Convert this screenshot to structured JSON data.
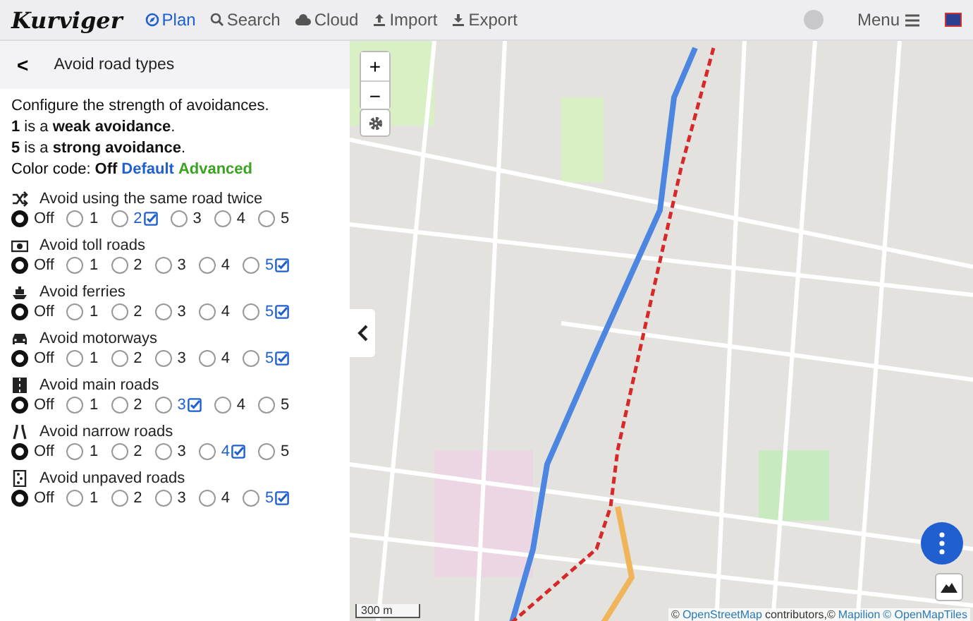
{
  "header": {
    "logo": "Kurviger",
    "nav": [
      {
        "label": "Plan",
        "kind": "plan",
        "selected": true
      },
      {
        "label": "Search",
        "kind": "search",
        "selected": false
      },
      {
        "label": "Cloud",
        "kind": "cloud",
        "selected": false
      },
      {
        "label": "Import",
        "kind": "import",
        "selected": false
      },
      {
        "label": "Export",
        "kind": "export",
        "selected": false
      }
    ],
    "menu": "Menu"
  },
  "panel": {
    "back": "<",
    "title": "Avoid road types",
    "intro": [
      "Configure the strength of avoidances.",
      "**1** is a **weak avoidance**.",
      "**5** is a **strong avoidance**."
    ],
    "color_code": {
      "label": "Color code:",
      "items": [
        {
          "label": "Off",
          "color": "#111111"
        },
        {
          "label": "Default",
          "color": "#1f5fd0"
        },
        {
          "label": "Advanced",
          "color": "#3aa321"
        }
      ]
    },
    "avoidances": [
      {
        "title": "Avoid using the same road twice",
        "kind": "shuffle",
        "options": [
          {
            "label": "Off",
            "selected": true,
            "default": false
          },
          {
            "label": "1",
            "selected": false,
            "default": false
          },
          {
            "label": "2",
            "selected": false,
            "default": true
          },
          {
            "label": "3",
            "selected": false,
            "default": false
          },
          {
            "label": "4",
            "selected": false,
            "default": false
          },
          {
            "label": "5",
            "selected": false,
            "default": false
          }
        ]
      },
      {
        "title": "Avoid toll roads",
        "kind": "money",
        "options": [
          {
            "label": "Off",
            "selected": true,
            "default": false
          },
          {
            "label": "1",
            "selected": false,
            "default": false
          },
          {
            "label": "2",
            "selected": false,
            "default": false
          },
          {
            "label": "3",
            "selected": false,
            "default": false
          },
          {
            "label": "4",
            "selected": false,
            "default": false
          },
          {
            "label": "5",
            "selected": false,
            "default": true
          }
        ]
      },
      {
        "title": "Avoid ferries",
        "kind": "ship",
        "options": [
          {
            "label": "Off",
            "selected": true,
            "default": false
          },
          {
            "label": "1",
            "selected": false,
            "default": false
          },
          {
            "label": "2",
            "selected": false,
            "default": false
          },
          {
            "label": "3",
            "selected": false,
            "default": false
          },
          {
            "label": "4",
            "selected": false,
            "default": false
          },
          {
            "label": "5",
            "selected": false,
            "default": true
          }
        ]
      },
      {
        "title": "Avoid motorways",
        "kind": "car",
        "options": [
          {
            "label": "Off",
            "selected": true,
            "default": false
          },
          {
            "label": "1",
            "selected": false,
            "default": false
          },
          {
            "label": "2",
            "selected": false,
            "default": false
          },
          {
            "label": "3",
            "selected": false,
            "default": false
          },
          {
            "label": "4",
            "selected": false,
            "default": false
          },
          {
            "label": "5",
            "selected": false,
            "default": true
          }
        ]
      },
      {
        "title": "Avoid main roads",
        "kind": "road",
        "options": [
          {
            "label": "Off",
            "selected": true,
            "default": false
          },
          {
            "label": "1",
            "selected": false,
            "default": false
          },
          {
            "label": "2",
            "selected": false,
            "default": false
          },
          {
            "label": "3",
            "selected": false,
            "default": true
          },
          {
            "label": "4",
            "selected": false,
            "default": false
          },
          {
            "label": "5",
            "selected": false,
            "default": false
          }
        ]
      },
      {
        "title": "Avoid narrow roads",
        "kind": "narrow",
        "options": [
          {
            "label": "Off",
            "selected": true,
            "default": false
          },
          {
            "label": "1",
            "selected": false,
            "default": false
          },
          {
            "label": "2",
            "selected": false,
            "default": false
          },
          {
            "label": "3",
            "selected": false,
            "default": false
          },
          {
            "label": "4",
            "selected": false,
            "default": true
          },
          {
            "label": "5",
            "selected": false,
            "default": false
          }
        ]
      },
      {
        "title": "Avoid unpaved roads",
        "kind": "unpaved",
        "options": [
          {
            "label": "Off",
            "selected": true,
            "default": false
          },
          {
            "label": "1",
            "selected": false,
            "default": false
          },
          {
            "label": "2",
            "selected": false,
            "default": false
          },
          {
            "label": "3",
            "selected": false,
            "default": false
          },
          {
            "label": "4",
            "selected": false,
            "default": false
          },
          {
            "label": "5",
            "selected": false,
            "default": true
          }
        ]
      }
    ]
  },
  "map": {
    "zoom_in": "+",
    "zoom_out": "−",
    "scale": "300 m",
    "attribution": [
      {
        "text": "©",
        "link": false
      },
      {
        "text": "OpenStreetMap",
        "link": true
      },
      {
        "text": "contributors,©",
        "link": false
      },
      {
        "text": "Mapilion",
        "link": true
      },
      {
        "text": "© OpenMapTiles",
        "link": true
      }
    ]
  }
}
